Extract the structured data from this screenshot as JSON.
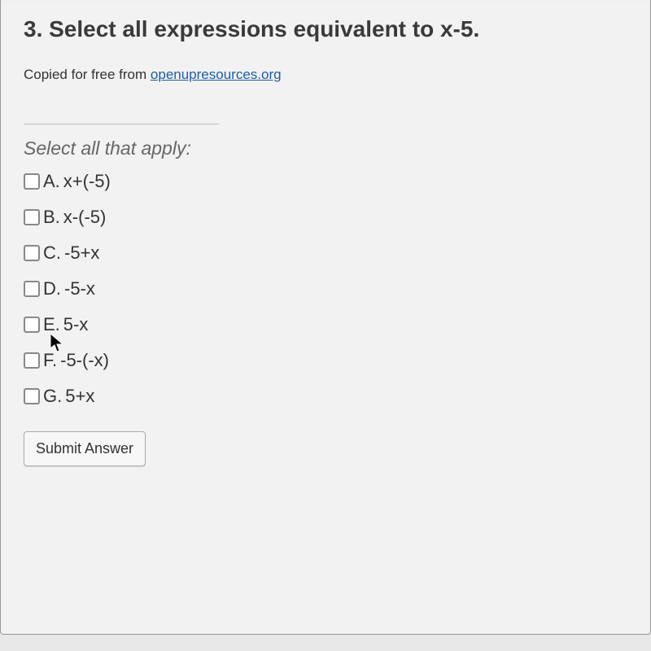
{
  "question": {
    "number_prefix": "3.",
    "title": "3. Select all expressions equivalent to x-5."
  },
  "attribution": {
    "prefix": "Copied for free from ",
    "link_text": "openupresources.org",
    "link_href": "#"
  },
  "instruction": "Select all that apply:",
  "options": [
    {
      "letter": "A.",
      "text": "x+(-5)"
    },
    {
      "letter": "B.",
      "text": "x-(-5)"
    },
    {
      "letter": "C.",
      "text": "-5+x"
    },
    {
      "letter": "D.",
      "text": "-5-x"
    },
    {
      "letter": "E.",
      "text": "5-x"
    },
    {
      "letter": "F.",
      "text": "-5-(-x)"
    },
    {
      "letter": "G.",
      "text": "5+x"
    }
  ],
  "submit_label": "Submit Answer"
}
